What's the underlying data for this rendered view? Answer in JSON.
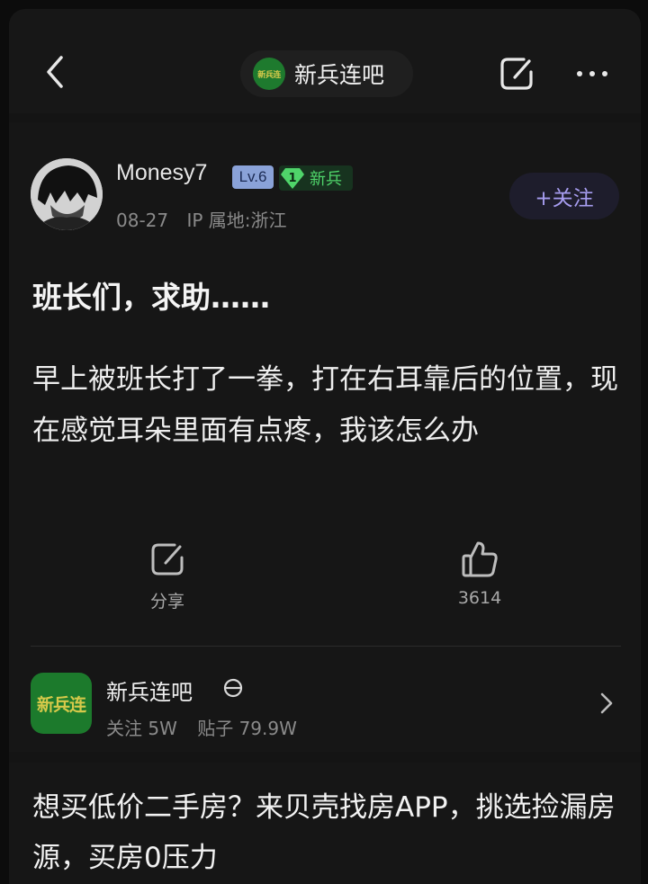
{
  "header": {
    "forum_logo_text": "新兵连",
    "forum_name": "新兵连吧"
  },
  "post": {
    "username": "Monesy7",
    "level_badge": "Lv.6",
    "rank_number": "1",
    "rank_title": "新兵",
    "date": "08-27",
    "ip_location": "IP 属地:浙江",
    "follow_label": "+关注",
    "title": "班长们，求助……",
    "body": "早上被班长打了一拳，打在右耳靠后的位置，现在感觉耳朵里面有点疼，我该怎么办",
    "actions": {
      "share_label": "分享",
      "like_count": "3614"
    }
  },
  "forum_card": {
    "logo_text": "新兵连",
    "name": "新兵连吧",
    "followers": "关注 5W",
    "posts": "贴子 79.9W"
  },
  "ad": {
    "text": "想买低价二手房？来贝壳找房APP，挑选捡漏房源，买房0压力"
  },
  "colors": {
    "background": "#141414",
    "follow_accent": "#a79df0",
    "rank_green": "#4fd46a",
    "forum_green": "#1c7a2c"
  }
}
